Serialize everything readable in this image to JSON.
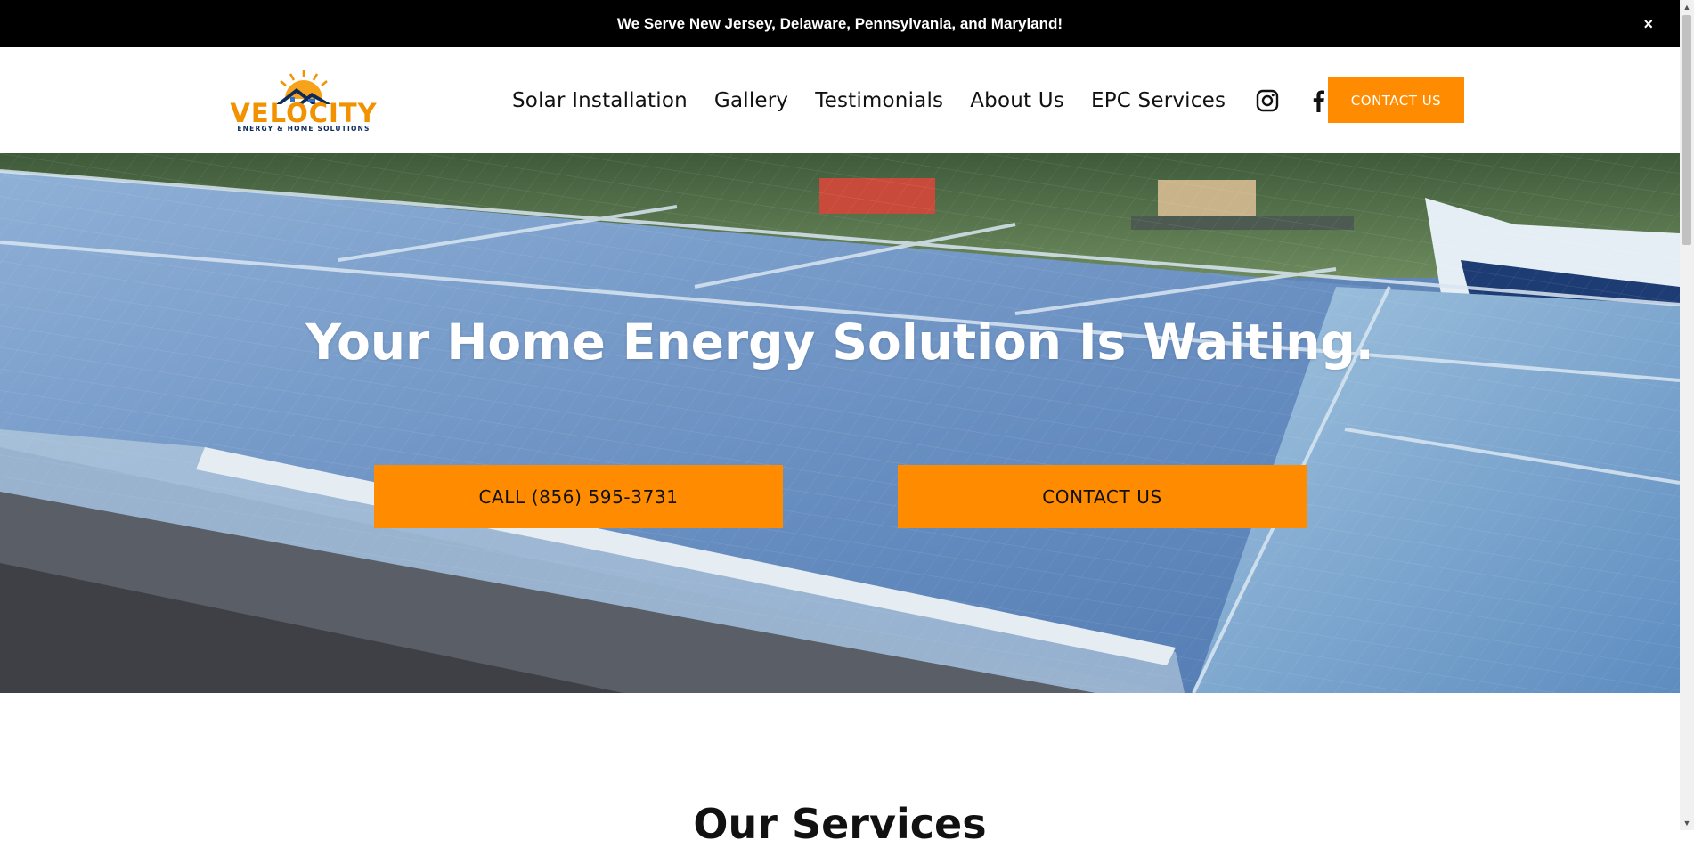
{
  "announcement": {
    "text": "We Serve New Jersey, Delaware, Pennsylvania, and Maryland!",
    "close_label": "×"
  },
  "header": {
    "logo": {
      "name": "VELOCITY",
      "tagline": "ENERGY & HOME SOLUTIONS"
    },
    "nav": [
      {
        "label": "Solar Installation"
      },
      {
        "label": "Gallery"
      },
      {
        "label": "Testimonials"
      },
      {
        "label": "About Us"
      },
      {
        "label": "EPC Services"
      }
    ],
    "social": [
      "instagram-icon",
      "facebook-icon"
    ],
    "cta_label": "CONTACT US"
  },
  "hero": {
    "title": "Your Home Energy Solution Is Waiting.",
    "call_label": "CALL (856) 595-3731",
    "contact_label": "CONTACT US"
  },
  "services": {
    "title": "Our Services"
  },
  "colors": {
    "accent": "#ff8c00",
    "announcement_bg": "#000000",
    "text": "#111111"
  }
}
